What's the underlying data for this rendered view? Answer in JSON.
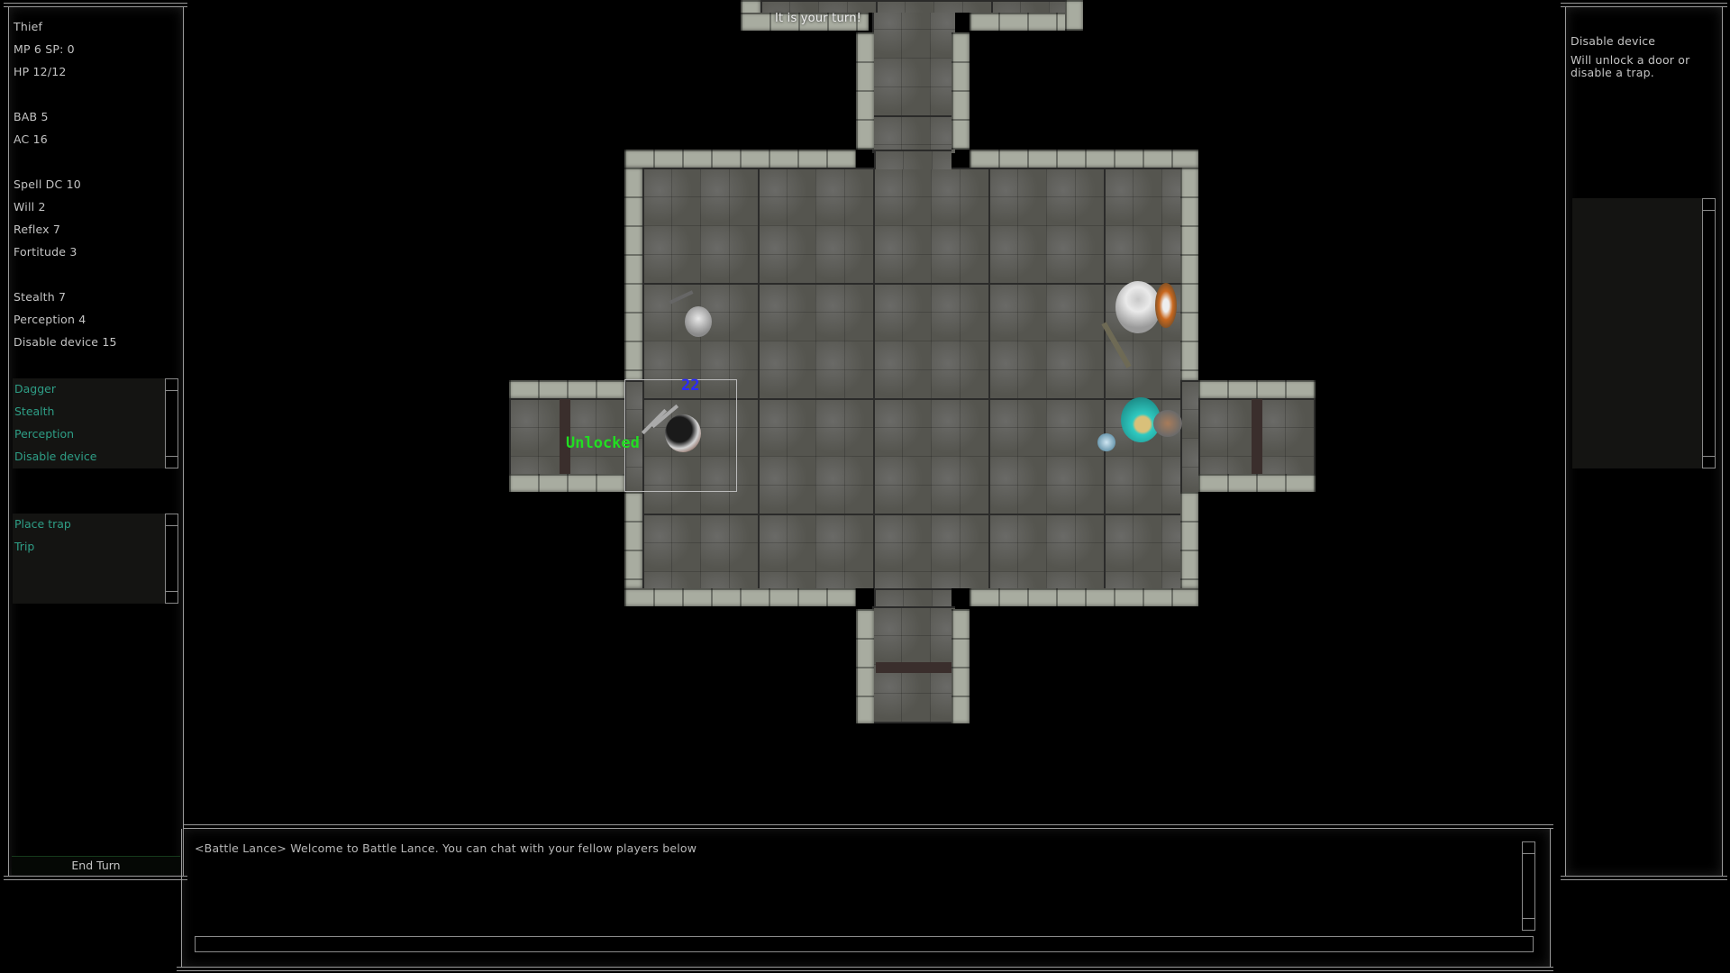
{
  "top_banner": {
    "text": "It is your turn!"
  },
  "character": {
    "stats": [
      "Thief",
      "MP 6 SP: 0",
      "HP 12/12",
      "",
      "BAB 5",
      "AC 16",
      "",
      "Spell DC 10",
      "Will 2",
      "Reflex 7",
      "Fortitude 3",
      "",
      "Stealth 7",
      "Perception 4",
      "Disable device 15"
    ],
    "skills": [
      "Dagger",
      "Stealth",
      "Perception",
      "Disable device"
    ],
    "actions": [
      "Place trap",
      "Trip"
    ],
    "end_turn_label": "End Turn"
  },
  "info_panel": {
    "title": "Disable device",
    "description": "Will unlock a door or disable a trap."
  },
  "map": {
    "selected_unit": {
      "name": "thief-player",
      "damage_popup": "22",
      "status_popup": "Unlocked"
    },
    "units": [
      {
        "name": "skeleton-enemy"
      },
      {
        "name": "dwarf-warrior-enemy"
      },
      {
        "name": "hooded-mage-enemy"
      }
    ],
    "colors": {
      "damage_popup": "#2a2aff",
      "status_popup": "#22dd22",
      "skill_text": "#2e9e86"
    }
  },
  "chat": {
    "messages": [
      "<Battle Lance> Welcome to Battle Lance. You can chat with your fellow players below"
    ],
    "input_value": "",
    "input_placeholder": ""
  }
}
